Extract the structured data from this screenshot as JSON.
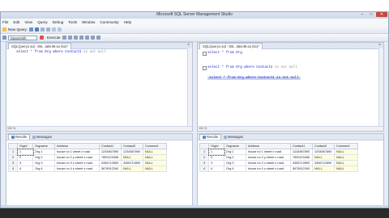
{
  "window": {
    "title": "Microsoft SQL Server Management Studio",
    "minimize": "–",
    "maximize": "□",
    "close": "✕"
  },
  "menu": [
    "File",
    "Edit",
    "View",
    "Query",
    "Debug",
    "Tools",
    "Window",
    "Community",
    "Help"
  ],
  "toolbar": {
    "new_query": "New Query",
    "database": "DataSmith",
    "execute": "Execute"
  },
  "editor_left": {
    "tab": "SQLQuery1.sql - DB...talent9.sa (51)*",
    "close": "×",
    "line1_kw": "select * from Org where Contact2 ",
    "line1_tail": "is not null"
  },
  "editor_right": {
    "tab": "SQLQuery1.sql - DB...talent9.sa (51)*",
    "close": "×",
    "line1_kw": "select * from Org",
    "line2_kw": "select * from Org where Contact2 ",
    "line2_tail": "is not null",
    "line3": "select * from Org where Contact2 is not null",
    "ctl1": "-",
    "ctl2": "-"
  },
  "zoom": "100 %",
  "results_tabs": {
    "results": "Results",
    "messages": "Messages"
  },
  "grid": {
    "columns": [
      "OrgId",
      "Orgname",
      "Address",
      "Contact1",
      "Contact2",
      "Comment"
    ],
    "rows": [
      {
        "rn": "1",
        "id": "1",
        "name": "Org 1",
        "addr": "house no 1 street x road",
        "c1": "1234567890",
        "c2": "1234567890",
        "cm": "NULL"
      },
      {
        "rn": "2",
        "id": "2",
        "name": "Org 2",
        "addr": "house no 2 y street x road",
        "c1": "7890123456",
        "c2": "NULL",
        "cm": "NULL"
      },
      {
        "rn": "3",
        "id": "3",
        "name": "Org 3",
        "addr": "house no 3 z street x road",
        "c1": "3456712890",
        "c2": "3456712890",
        "cm": "NULL"
      },
      {
        "rn": "4",
        "id": "4",
        "name": "Org 4",
        "addr": "house no 4 z street x road",
        "c1": "5678912340",
        "c2": "NULL",
        "cm": "NULL"
      }
    ]
  },
  "colors": {
    "accent": "#1a1ad0",
    "selection": "#c7d6ee",
    "null_cell": "#fffde0",
    "close_button": "#c9463d"
  },
  "icons": [
    "new-query-icon",
    "database-icon",
    "execute-icon",
    "save-icon",
    "open-icon",
    "results-grid-icon",
    "messages-icon"
  ]
}
